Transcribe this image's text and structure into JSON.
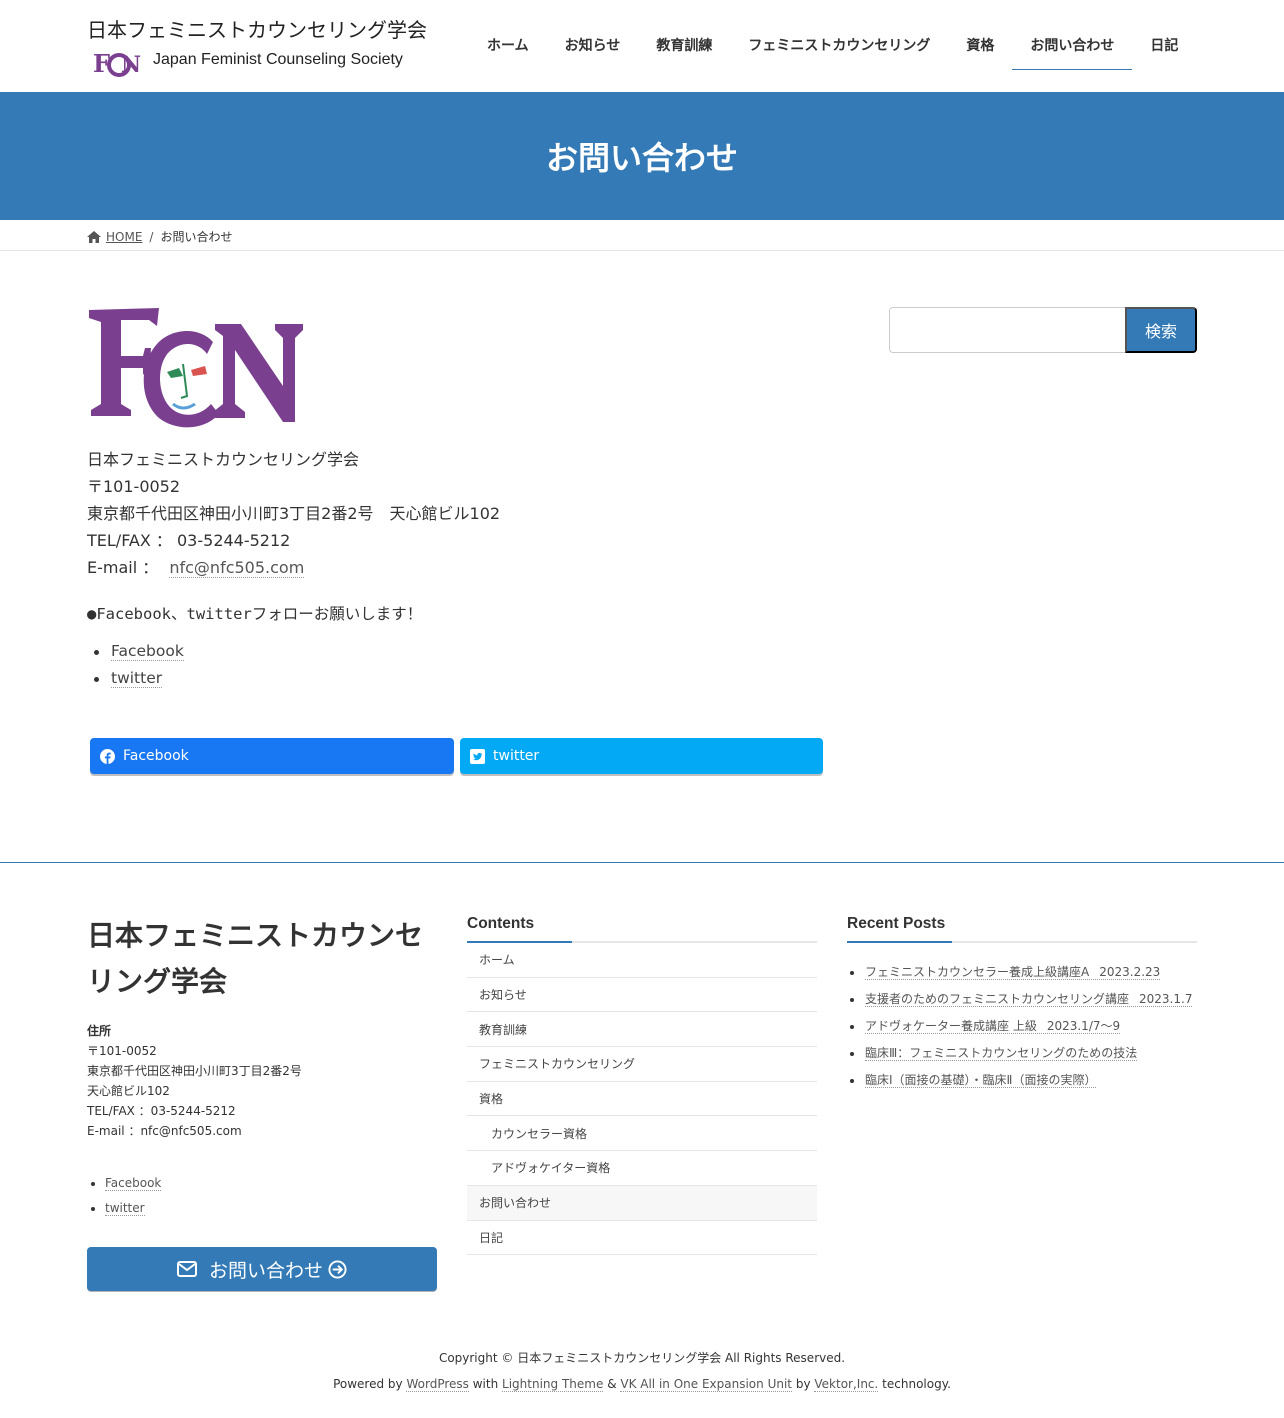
{
  "header": {
    "site_title": "日本フェミニストカウンセリング学会",
    "site_subtitle": "Japan Feminist Counseling Society",
    "logo_text": "FCN",
    "nav": [
      {
        "label": "ホーム"
      },
      {
        "label": "お知らせ"
      },
      {
        "label": "教育訓練"
      },
      {
        "label": "フェミニストカウンセリング"
      },
      {
        "label": "資格"
      },
      {
        "label": "お問い合わせ",
        "current": true
      },
      {
        "label": "日記"
      }
    ]
  },
  "page_title": "お問い合わせ",
  "breadcrumb": {
    "home": "HOME",
    "sep": "/",
    "current": "お問い合わせ"
  },
  "main": {
    "logo_text": "FCN",
    "org_name": "日本フェミニストカウンセリング学会",
    "postal": "〒101-0052",
    "address": "東京都千代田区神田小川町3丁目2番2号　天心館ビル102",
    "tel_label": "TEL/FAX ： 03-5244-5212",
    "email_label": "E-mail ：",
    "email": "nfc@nfc505.com",
    "follow_text": "●Facebook、twitterフォローお願いします！",
    "sns_links": [
      "Facebook",
      "twitter"
    ],
    "share_facebook": "Facebook",
    "share_twitter": "twitter"
  },
  "sidebar": {
    "search_placeholder": "",
    "search_button": "検索"
  },
  "footer": {
    "title": "日本フェミニストカウンセリング学会",
    "address_label": "住所",
    "address_lines": [
      "〒101-0052",
      "東京都千代田区神田小川町3丁目2番2号",
      "天心館ビル102",
      "TEL/FAX ：03-5244-5212",
      "E-mail ：nfc@nfc505.com"
    ],
    "sns_links": [
      "Facebook",
      "twitter"
    ],
    "contact_button": "お問い合わせ",
    "contents_title": "Contents",
    "contents": [
      {
        "label": "ホーム"
      },
      {
        "label": "お知らせ"
      },
      {
        "label": "教育訓練"
      },
      {
        "label": "フェミニストカウンセリング"
      },
      {
        "label": "資格"
      },
      {
        "label": "カウンセラー資格",
        "sub": true
      },
      {
        "label": "アドヴォケイター資格",
        "sub": true
      },
      {
        "label": "お問い合わせ",
        "current": true
      },
      {
        "label": "日記"
      }
    ],
    "recent_title": "Recent Posts",
    "recent_posts": [
      {
        "title": "フェミニストカウンセラー養成上級講座A",
        "date": "2023.2.23"
      },
      {
        "title": "支援者のためのフェミニストカウンセリング講座",
        "date": "2023.1.7"
      },
      {
        "title": "アドヴォケーター養成講座 上級",
        "date": "2023.1/7〜9"
      },
      {
        "title": "臨床Ⅲ：フェミニストカウンセリングのための技法",
        "date": ""
      },
      {
        "title": "臨床Ⅰ（面接の基礎）・臨床Ⅱ（面接の実際）",
        "date": ""
      }
    ],
    "copyright": "Copyright © 日本フェミニストカウンセリング学会 All Rights Reserved.",
    "powered": {
      "prefix": "Powered by",
      "wordpress": "WordPress",
      "with": "with",
      "theme": "Lightning Theme",
      "amp": "&",
      "vk": "VK All in One Expansion Unit",
      "by": "by",
      "vektor": "Vektor,Inc.",
      "suffix": "technology."
    }
  },
  "colors": {
    "accent": "#337ab7",
    "facebook": "#1877f2",
    "twitter": "#03a9f4",
    "logo_purple": "#7a3f8f"
  }
}
